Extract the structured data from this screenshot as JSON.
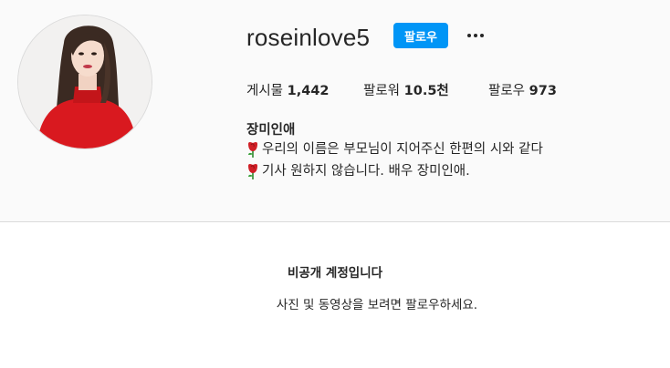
{
  "profile": {
    "username": "roseinlove5",
    "follow_label": "팔로우",
    "more_label": "더 보기",
    "full_name": "장미인애",
    "bio_lines": [
      "우리의 이름은 부모님이 지어주신 한편의 시와 같다",
      "기사 원하지 않습니다. 배우 장미인애."
    ],
    "bio_icon": "rose-emoji-icon"
  },
  "stats": {
    "posts_label": "게시물",
    "posts_value": "1,442",
    "followers_label": "팔로워",
    "followers_value": "10.5천",
    "following_label": "팔로우",
    "following_value": "973"
  },
  "private": {
    "title": "비공개 계정입니다",
    "description": "사진 및 동영상을 보려면 팔로우하세요."
  },
  "colors": {
    "accent": "#0095f6",
    "text": "#262626",
    "background": "#fafafa",
    "divider": "#dbdbdb"
  }
}
